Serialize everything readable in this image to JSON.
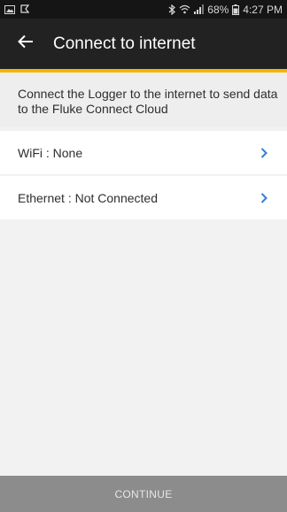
{
  "status_bar": {
    "left_icons": [
      "image-notification-icon",
      "flag-notification-icon"
    ],
    "right_icons": [
      "bluetooth-icon",
      "wifi-icon",
      "signal-icon",
      "battery-icon"
    ],
    "battery": "68%",
    "time": "4:27 PM"
  },
  "app_bar": {
    "back_icon": "arrow-left-icon",
    "title": "Connect to internet"
  },
  "intro_text": "Connect the Logger to the internet to send data to the Fluke Connect Cloud",
  "options": [
    {
      "label": "WiFi : None",
      "icon": "chevron-right-icon"
    },
    {
      "label": "Ethernet : Not Connected",
      "icon": "chevron-right-icon"
    }
  ],
  "continue_label": "CONTINUE",
  "colors": {
    "app_bar": "#222222",
    "accent": "#f4b400",
    "chevron": "#2f80d8",
    "button": "#8c8c8c"
  }
}
